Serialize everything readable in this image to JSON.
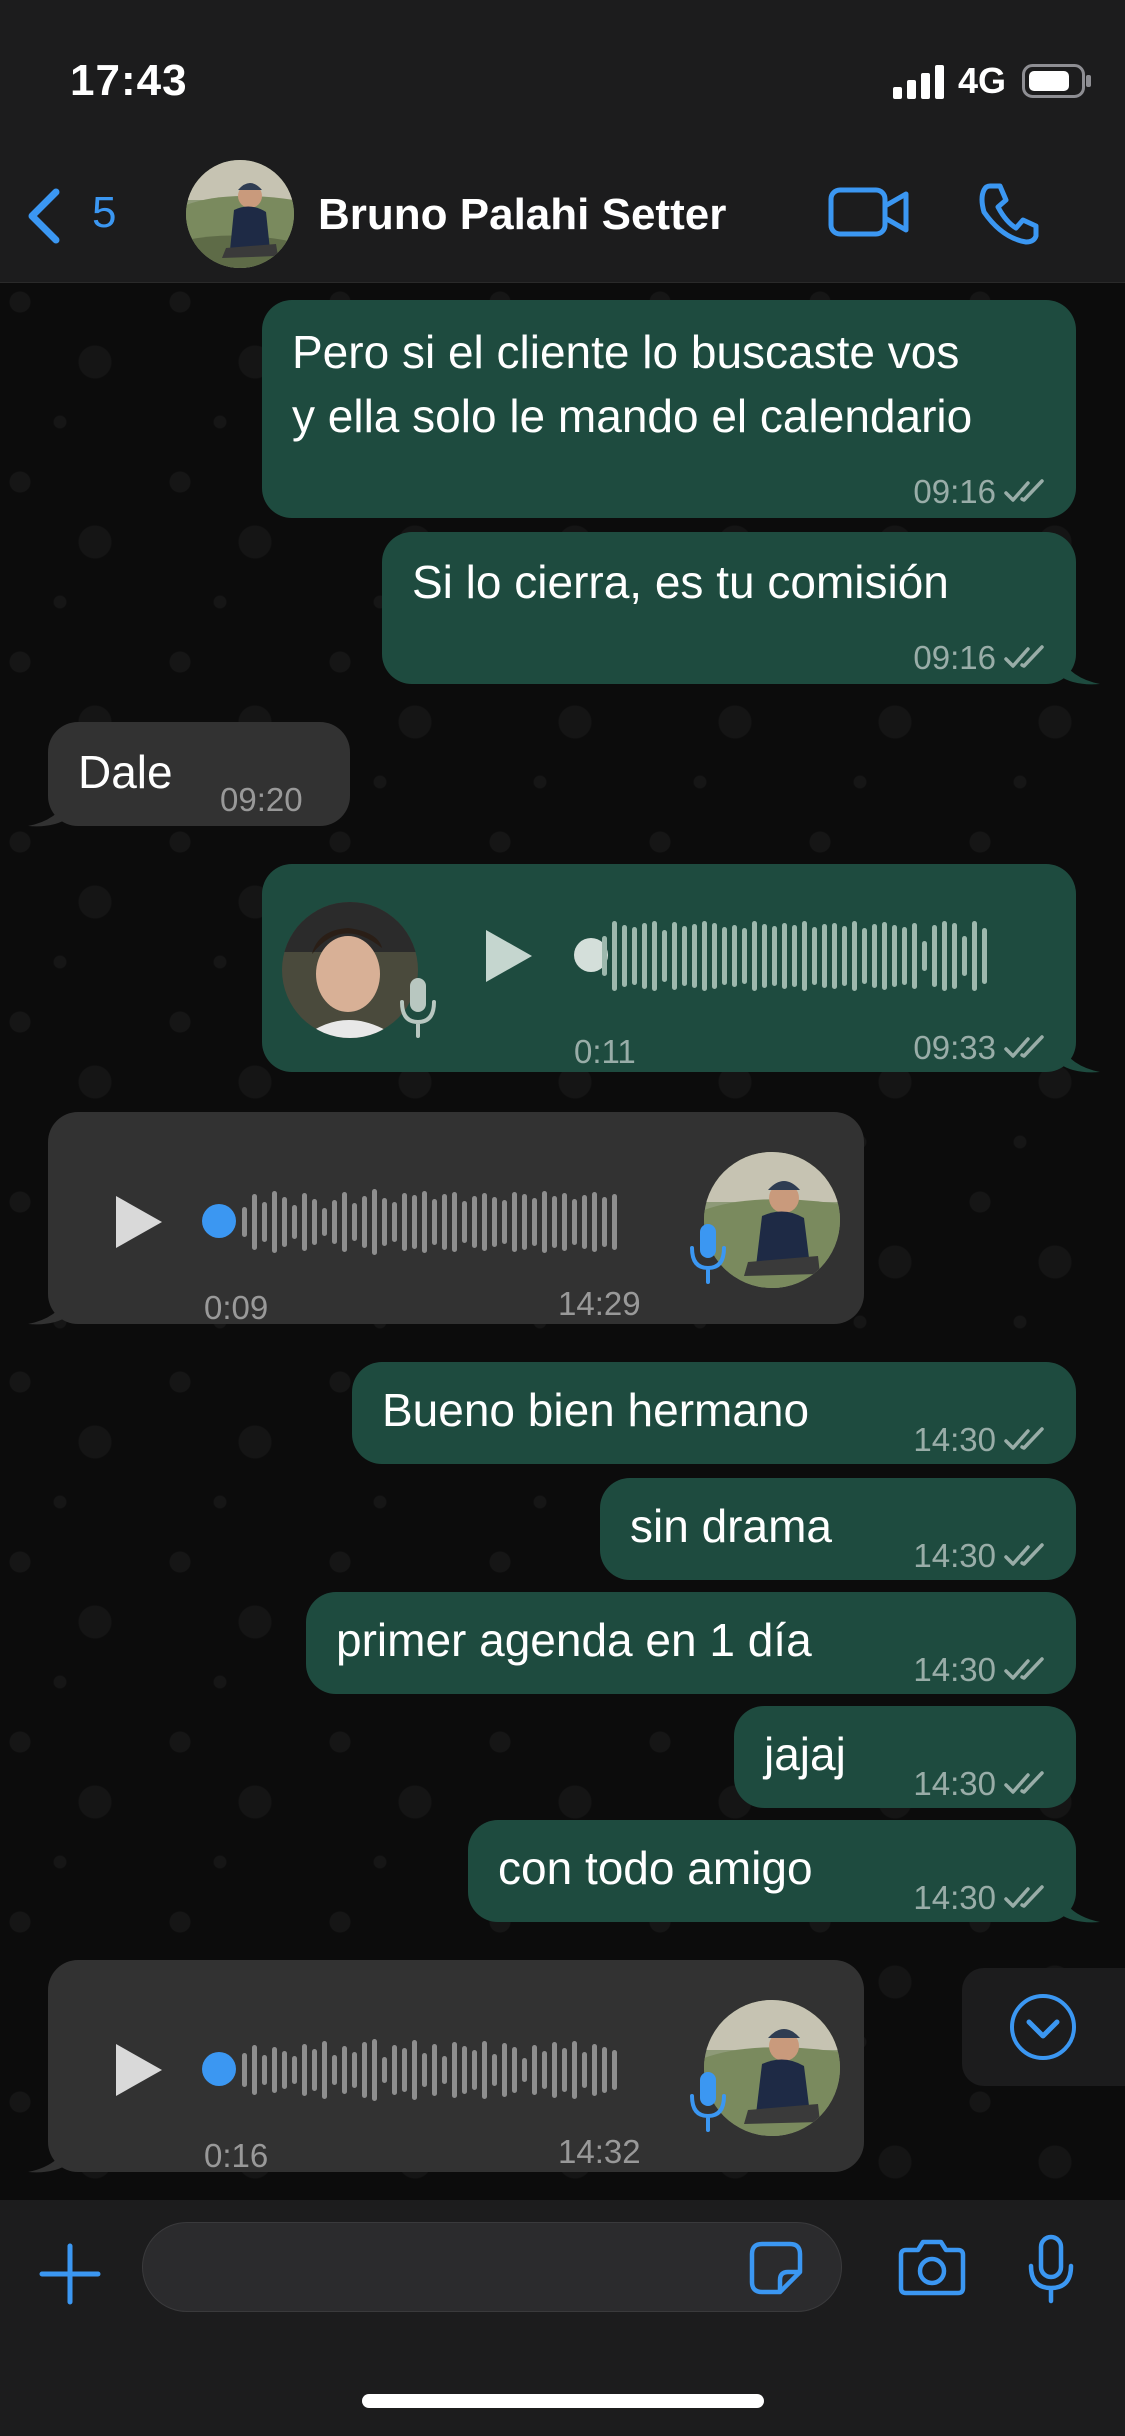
{
  "status_bar": {
    "time": "17:43",
    "network": "4G"
  },
  "header": {
    "back_count": "5",
    "contact_name": "Bruno Palahi Setter"
  },
  "messages": [
    {
      "type": "text",
      "direction": "out",
      "lines": [
        "Pero si el cliente lo buscaste vos",
        "y ella solo le mando el calendario"
      ],
      "time": "09:16",
      "read": true
    },
    {
      "type": "text",
      "direction": "out",
      "lines": [
        "Si lo cierra, es tu comisión"
      ],
      "time": "09:16",
      "read": true
    },
    {
      "type": "text",
      "direction": "in",
      "lines": [
        "Dale"
      ],
      "time": "09:20"
    },
    {
      "type": "voice",
      "direction": "out",
      "duration": "0:11",
      "time": "09:33",
      "read": true
    },
    {
      "type": "voice",
      "direction": "in",
      "duration": "0:09",
      "time": "14:29"
    },
    {
      "type": "text",
      "direction": "out",
      "lines": [
        "Bueno bien hermano"
      ],
      "time": "14:30",
      "read": true
    },
    {
      "type": "text",
      "direction": "out",
      "lines": [
        "sin drama"
      ],
      "time": "14:30",
      "read": true
    },
    {
      "type": "text",
      "direction": "out",
      "lines": [
        "primer agenda en 1 día"
      ],
      "time": "14:30",
      "read": true
    },
    {
      "type": "text",
      "direction": "out",
      "lines": [
        "jajaj"
      ],
      "time": "14:30",
      "read": true
    },
    {
      "type": "text",
      "direction": "out",
      "lines": [
        "con todo amigo"
      ],
      "time": "14:30",
      "read": true
    },
    {
      "type": "voice",
      "direction": "in",
      "duration": "0:16",
      "time": "14:32"
    }
  ],
  "input": {
    "placeholder": ""
  },
  "colors": {
    "accent": "#3b97f2",
    "outgoing_bubble": "#1e4b3f",
    "incoming_bubble": "#323232",
    "bar_background": "#1c1c1d"
  },
  "icons": [
    "back-chevron-icon",
    "video-call-icon",
    "phone-icon",
    "play-icon",
    "mic-icon",
    "read-receipt-icon",
    "chevron-down-icon",
    "plus-icon",
    "sticker-icon",
    "camera-icon"
  ]
}
